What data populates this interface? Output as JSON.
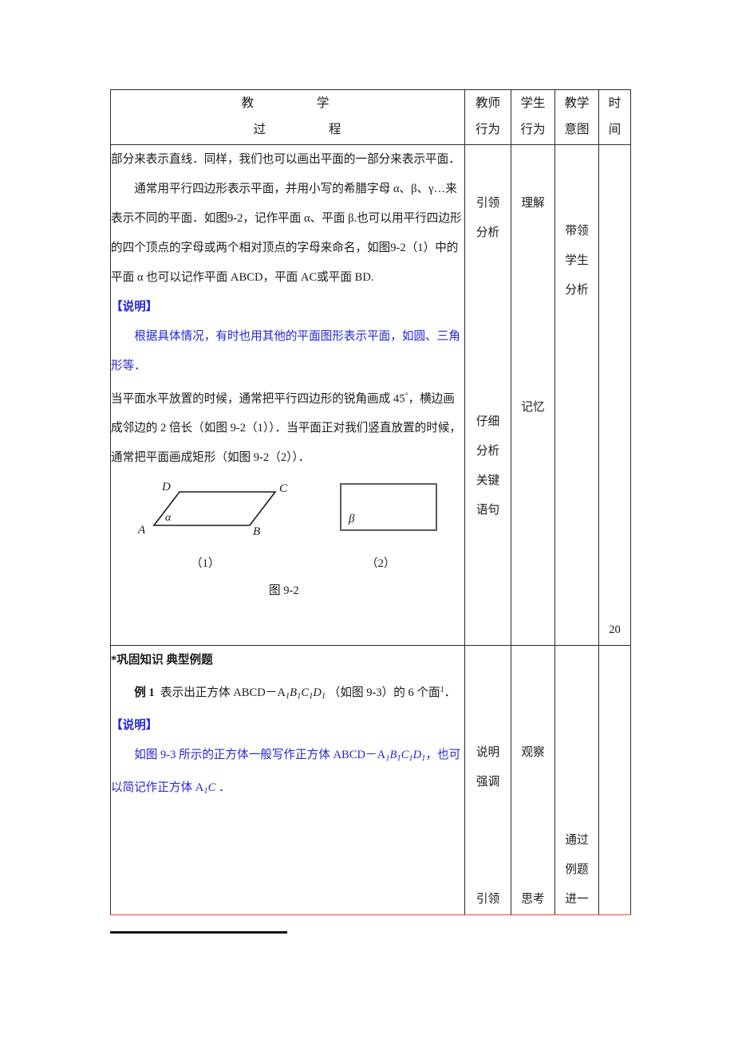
{
  "table": {
    "headers": {
      "process_line1": "教　　学",
      "process_line2": "过　　程",
      "teacher_l1": "教师",
      "teacher_l2": "行为",
      "student_l1": "学生",
      "student_l2": "行为",
      "intent_l1": "教学",
      "intent_l2": "意图",
      "time_l1": "时",
      "time_l2": "间"
    },
    "row1": {
      "paragraphs": [
        "部分来表示直线．同样，我们也可以画出平面的一部分来表示平面．",
        "通常用平行四边形表示平面，并用小写的希腊字母 α、β、γ…来表示不同的平面．如图9-2，记作平面 α、平面 β.也可以用平行四边形的四个顶点的字母或两个相对顶点的字母来命名，如图9-2（1）中的平面 α 也可以记作平面 ABCD，平面 AC或平面 BD."
      ],
      "note_title": "【说明】",
      "note_body": "根据具体情况，有时也用其他的平面图形表示平面，如圆、三角形等．",
      "paragraph3_a": "当平面水平放置的时候，通常把平行四边形的锐角画成 45",
      "paragraph3_b": "，横边画成邻边的 2 倍长（如图 9-2（1））．当平面正对我们竖直放置的时候，通常把平面画成矩形（如图 9-2（2））．",
      "figure": {
        "vertex_a": "A",
        "vertex_b": "B",
        "vertex_c": "C",
        "vertex_d": "D",
        "alpha": "α",
        "beta": "β",
        "caption_1": "（1）",
        "caption_2": "（2）",
        "caption_main": "图 9-2"
      },
      "teacher": [
        "引领",
        "分析"
      ],
      "teacher2": [
        "仔细",
        "分析",
        "关键",
        "语句"
      ],
      "student": [
        "理解"
      ],
      "student2": [
        "记忆"
      ],
      "intent": [
        "带领",
        "学生",
        "分析"
      ],
      "time": "20"
    },
    "row2": {
      "heading": "*巩固知识 典型例题",
      "example_label": "例 1",
      "example_text_a": "表示出正方体 ABCD－A",
      "example_text_b": "（如图 9-3）的 6 个面",
      "example_text_c": "．",
      "note_title": "【说明】",
      "note_body_a": "如图 9-3 所示的正方体一般写作正方体 ABCD－A",
      "note_body_b": "，也可以简记作正方体 A",
      "note_body_c": "．",
      "teacher": [
        "说明",
        "强调"
      ],
      "teacher2": [
        "引领"
      ],
      "student": [
        "观察"
      ],
      "student2": [
        "思考"
      ],
      "intent": [
        "通过",
        "例题",
        "进一"
      ],
      "time": ""
    }
  },
  "colors": {
    "note_blue": "#2525d6",
    "separator_red": "#f44336",
    "border": "#2b2b2b"
  }
}
